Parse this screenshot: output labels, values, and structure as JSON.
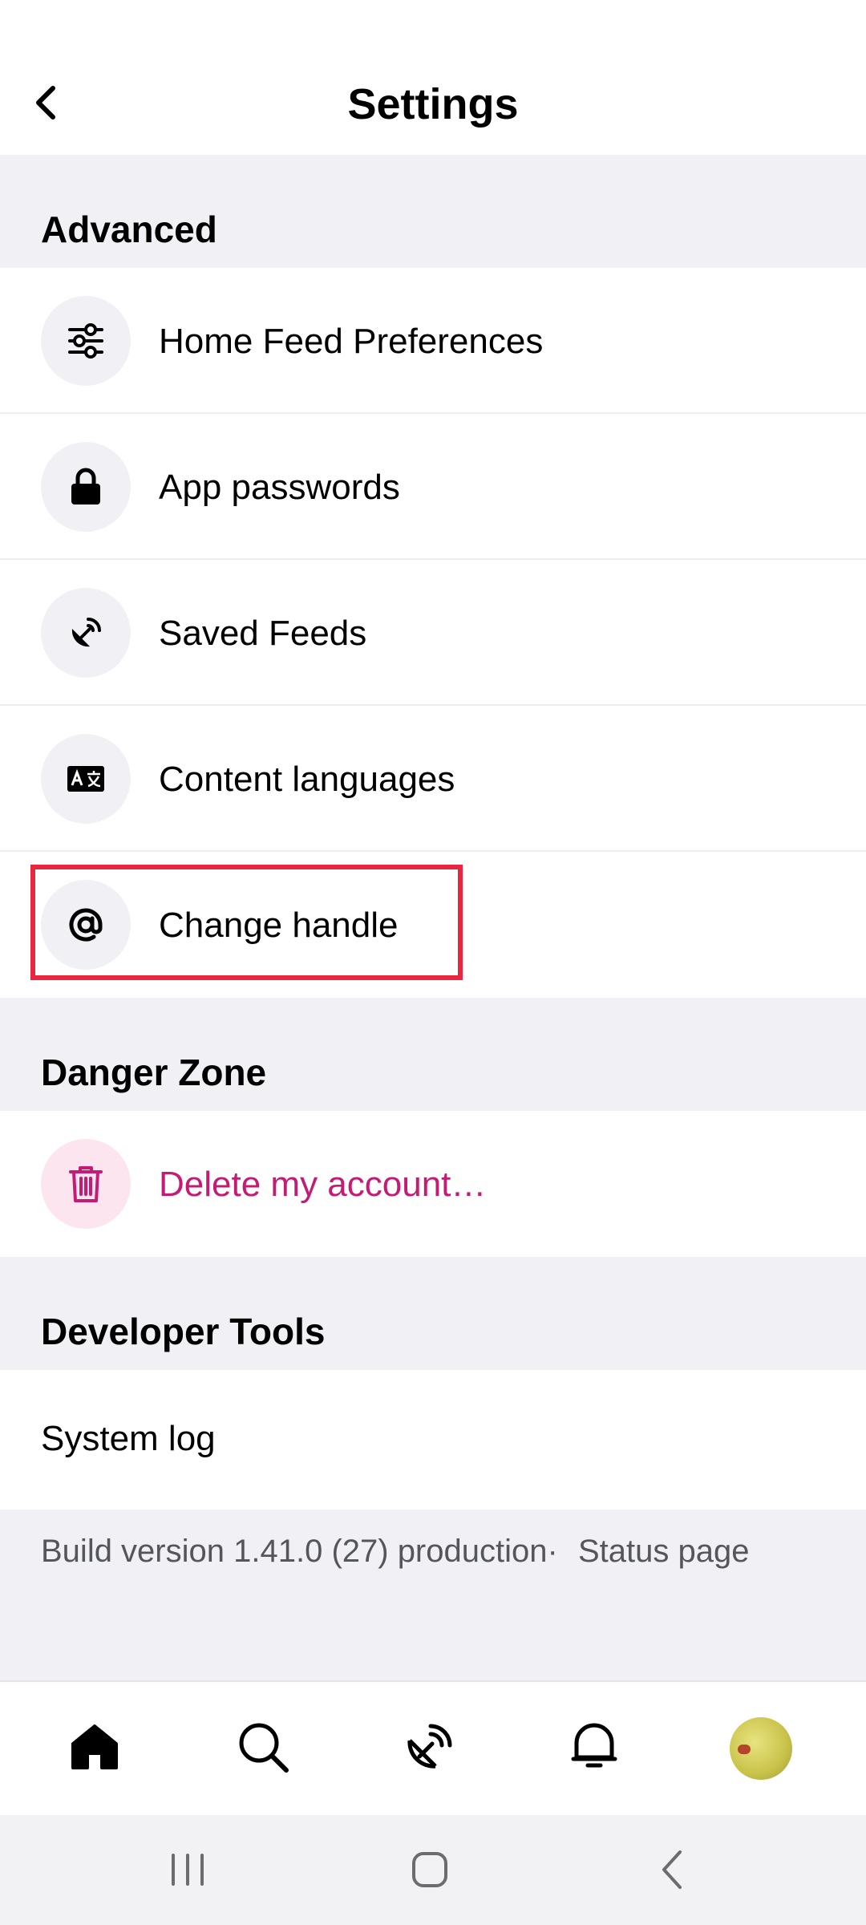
{
  "header": {
    "title": "Settings",
    "back_icon": "chevron-left-icon"
  },
  "sections": {
    "advanced": "Advanced",
    "danger_zone": "Danger Zone",
    "developer_tools": "Developer Tools"
  },
  "advanced_items": [
    {
      "label": "Home Feed Preferences",
      "icon": "sliders-icon"
    },
    {
      "label": "App passwords",
      "icon": "lock-icon"
    },
    {
      "label": "Saved Feeds",
      "icon": "satellite-dish-icon"
    },
    {
      "label": "Content languages",
      "icon": "translate-icon"
    },
    {
      "label": "Change handle",
      "icon": "at-sign-icon"
    }
  ],
  "danger_items": [
    {
      "label": "Delete my account…",
      "icon": "trash-icon"
    }
  ],
  "developer_items": [
    {
      "label": "System log"
    }
  ],
  "footer": {
    "build_version": "Build version 1.41.0 (27) production·",
    "status_page": "Status page"
  },
  "bottom_nav": [
    {
      "icon": "home-icon"
    },
    {
      "icon": "search-icon"
    },
    {
      "icon": "feeds-icon"
    },
    {
      "icon": "notifications-icon"
    },
    {
      "icon": "profile-avatar"
    }
  ],
  "system_bar": [
    {
      "icon": "recent-apps-icon"
    },
    {
      "icon": "home-button-icon"
    },
    {
      "icon": "system-back-icon"
    }
  ],
  "colors": {
    "accent_danger": "#c41c74",
    "highlight_border": "#ea2540",
    "section_bg": "#f1f1f5"
  }
}
